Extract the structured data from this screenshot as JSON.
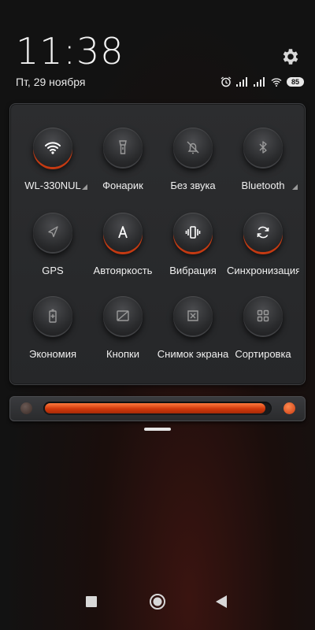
{
  "status": {
    "time": "11:38",
    "date": "Пт, 29 ноября",
    "battery": "85"
  },
  "toggles": [
    {
      "label": "WL-330NUL",
      "icon": "wifi-icon",
      "active": true,
      "has_menu": true
    },
    {
      "label": "Фонарик",
      "icon": "flashlight-icon",
      "active": false,
      "has_menu": false
    },
    {
      "label": "Без звука",
      "icon": "bell-off-icon",
      "active": false,
      "has_menu": false
    },
    {
      "label": "Bluetooth",
      "icon": "bluetooth-icon",
      "active": false,
      "has_menu": true
    },
    {
      "label": "GPS",
      "icon": "location-arrow-icon",
      "active": false,
      "has_menu": false
    },
    {
      "label": "Автояркость",
      "icon": "auto-brightness-icon",
      "active": true,
      "has_menu": false
    },
    {
      "label": "Вибрация",
      "icon": "vibrate-icon",
      "active": true,
      "has_menu": false
    },
    {
      "label": "Синхронизация",
      "icon": "sync-icon",
      "active": true,
      "has_menu": false
    },
    {
      "label": "Экономия",
      "icon": "battery-saver-icon",
      "active": false,
      "has_menu": false
    },
    {
      "label": "Кнопки",
      "icon": "buttons-icon",
      "active": false,
      "has_menu": false
    },
    {
      "label": "Снимок экрана",
      "icon": "screenshot-icon",
      "active": false,
      "has_menu": false
    },
    {
      "label": "Сортировка",
      "icon": "grid-icon",
      "active": false,
      "has_menu": false
    }
  ],
  "brightness": {
    "level": 0.98
  },
  "colors": {
    "accent": "#d9420f",
    "panel": "#2b2c2e",
    "background": "#121212"
  }
}
